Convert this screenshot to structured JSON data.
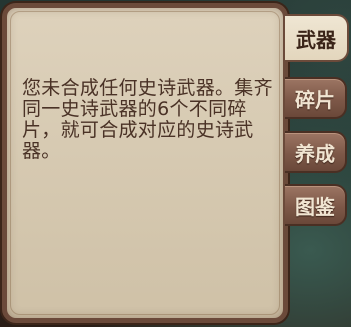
{
  "panel": {
    "message": "您未合成任何史诗武器。集齐同一史诗武器的6个不同碎片，就可合成对应的史诗武器。"
  },
  "tabs": [
    {
      "label": "武器",
      "active": true
    },
    {
      "label": "碎片",
      "active": false
    },
    {
      "label": "养成",
      "active": false
    },
    {
      "label": "图鉴",
      "active": false
    }
  ],
  "colors": {
    "panel_bg": "#d9ccb5",
    "panel_border": "#6b4a3a",
    "text": "#4a3226",
    "tab_inactive": "#7d5848",
    "tab_active": "#e9dfcb"
  }
}
